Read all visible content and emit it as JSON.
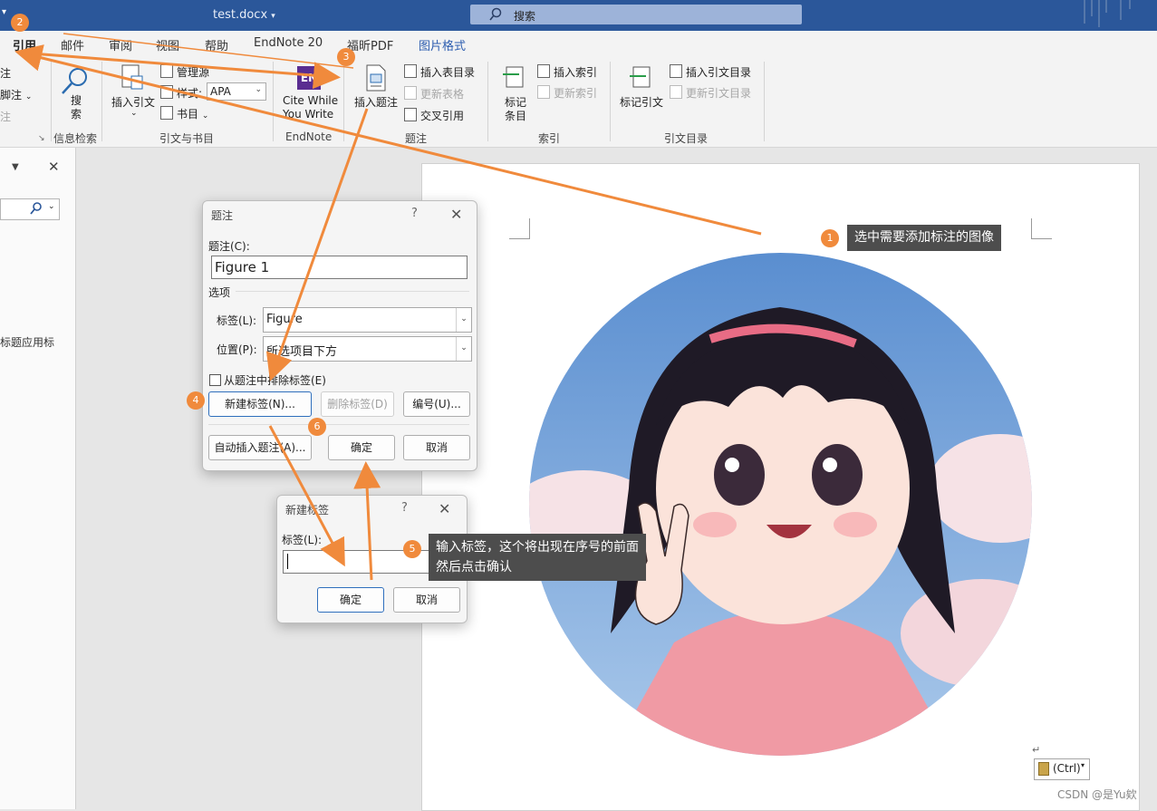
{
  "titlebar": {
    "doc_name": "test.docx",
    "doc_caret": "▾",
    "search_placeholder": "搜索",
    "qa_caret": "▾"
  },
  "tabs": [
    "引用",
    "邮件",
    "审阅",
    "视图",
    "帮助",
    "EndNote 20",
    "福昕PDF",
    "图片格式"
  ],
  "ribbon": {
    "left_partial": [
      "注",
      "脚注",
      "注"
    ],
    "search_btn": "搜\n索",
    "group_info": "信息检索",
    "insert_citation": "插入引文",
    "manage_sources": "管理源",
    "style_label": "样式:",
    "style_value": "APA",
    "bibliography": "书目",
    "group_citations": "引文与书目",
    "cite_while_1": "Cite While",
    "cite_while_2": "You Write",
    "en_logo": "EN",
    "group_endnote": "EndNote",
    "insert_caption": "插入题注",
    "insert_table_figures": "插入表目录",
    "update_table": "更新表格",
    "cross_reference": "交叉引用",
    "group_caption": "题注",
    "mark_entry_1": "标记",
    "mark_entry_2": "条目",
    "insert_index": "插入索引",
    "update_index": "更新索引",
    "group_index": "索引",
    "mark_citation": "标记引文",
    "insert_toa": "插入引文目录",
    "update_toa": "更新引文目录",
    "group_toa": "引文目录"
  },
  "leftpane": {
    "text": "标题应用标"
  },
  "caption_dialog": {
    "title": "题注",
    "help": "?",
    "close": "✕",
    "caption_label": "题注(C):",
    "caption_value": "Figure 1",
    "options_label": "选项",
    "label_label": "标签(L):",
    "label_value": "Figure",
    "position_label": "位置(P):",
    "position_value": "所选项目下方",
    "exclude_label": "从题注中排除标签(E)",
    "new_label_btn": "新建标签(N)...",
    "delete_label_btn": "删除标签(D)",
    "numbering_btn": "编号(U)...",
    "autocaption_btn": "自动插入题注(A)...",
    "ok_btn": "确定",
    "cancel_btn": "取消"
  },
  "new_label_dialog": {
    "title": "新建标签",
    "help": "?",
    "close": "✕",
    "label_label": "标签(L):",
    "label_value": "",
    "ok_btn": "确定",
    "cancel_btn": "取消"
  },
  "callouts": {
    "c1": "选中需要添加标注的图像",
    "c5_line1": "输入标签，这个将出现在序号的前面",
    "c5_line2": "然后点击确认"
  },
  "badges": [
    "1",
    "2",
    "3",
    "4",
    "5",
    "6"
  ],
  "paste_options": "(Ctrl)",
  "watermark": "CSDN @是Yu欸",
  "colors": {
    "accent": "#2b579a",
    "arrow": "#f08a3c",
    "callout_bg": "#4d4d4d"
  }
}
